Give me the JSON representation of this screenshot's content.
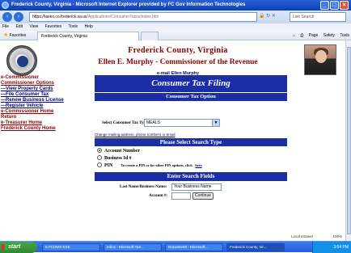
{
  "window": {
    "title": "Frederick County, Virginia - Microsoft Internet Explorer provided by FC Gov Information Technologies"
  },
  "browser": {
    "address_host": "https://taxes.co.frederick.va.us",
    "address_path": "/Applications/ConsumerTaxes/index.htm",
    "search_placeholder": "Live Search",
    "menu": [
      "File",
      "Edit",
      "View",
      "Favorites",
      "Tools",
      "Help"
    ],
    "favorites_label": "Favorites",
    "tab_title": "Frederick County, Virginia",
    "commands": [
      "Page",
      "Safety",
      "Tools"
    ],
    "zone": "Local intranet",
    "zoom": "100%"
  },
  "header": {
    "county": "Frederick County, Virginia",
    "official": "Ellen E. Murphy - Commissioner of the Revenue",
    "email": "e-mail Ellen Murphy"
  },
  "sidebar": {
    "items": [
      {
        "label": "e-Commissioner"
      },
      {
        "label": "Commissioner Options"
      },
      {
        "label": "—View Property Cards"
      },
      {
        "label": "—File Consumer Tax"
      },
      {
        "label": "—Renew Business License"
      },
      {
        "label": "—Register Vehicle"
      },
      {
        "label": "e-Commissioner Home"
      },
      {
        "label": "Return"
      },
      {
        "label": "e-Treasurer Home"
      },
      {
        "label": "Frederick County Home"
      }
    ]
  },
  "form": {
    "title": "Consumer Tax Filing",
    "option_heading": "Consumer Tax Option",
    "type_label": "Select Consumer Tax Type:",
    "type_value": "MEALS",
    "change_link": "Change mailing address, phone numbers or email",
    "search_heading": "Please Select Search Type",
    "radio_account": "Account Number",
    "radio_business": "Business Id #",
    "radio_pin": "PIN",
    "pin_note": "To create a PIN or for other PIN options, click",
    "pin_here": "here",
    "fields_heading": "Enter Search Fields",
    "name_label": "Last Name/Business Name:",
    "name_value": "Your Business Name",
    "account_label": "Account #:",
    "account_value": "",
    "continue_label": "Continue"
  },
  "taskbar": {
    "start": "start",
    "tasks": [
      "9 PCOMS-EXE",
      "Inbox - Microsoft Out...",
      "Document8 - Microsoft...",
      "Frederick County, Vir..."
    ],
    "clock": "3:04 PM"
  }
}
